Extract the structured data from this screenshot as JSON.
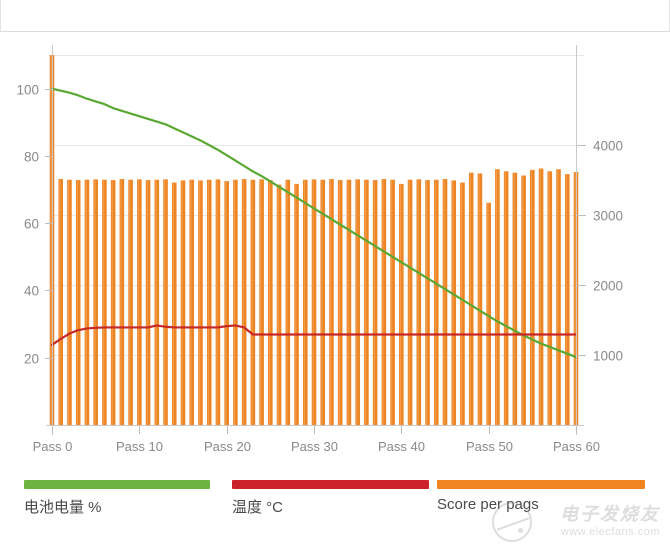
{
  "chart_data": {
    "type": "bar",
    "title": "",
    "subtitle": "",
    "xlabel": "",
    "ylabel": "",
    "y2label": "",
    "grid": true,
    "legend_position": "bottom",
    "x": [
      0,
      1,
      2,
      3,
      4,
      5,
      6,
      7,
      8,
      9,
      10,
      11,
      12,
      13,
      14,
      15,
      16,
      17,
      18,
      19,
      20,
      21,
      22,
      23,
      24,
      25,
      26,
      27,
      28,
      29,
      30,
      31,
      32,
      33,
      34,
      35,
      36,
      37,
      38,
      39,
      40,
      41,
      42,
      43,
      44,
      45,
      46,
      47,
      48,
      49,
      50,
      51,
      52,
      53,
      54,
      55,
      56,
      57,
      58,
      59,
      60
    ],
    "xtick_values": [
      0,
      10,
      20,
      30,
      40,
      50,
      60
    ],
    "xtick_labels": [
      "Pass 0",
      "Pass 10",
      "Pass 20",
      "Pass 30",
      "Pass 40",
      "Pass 50",
      "Pass 60"
    ],
    "ylim": [
      0,
      110
    ],
    "ytick_values": [
      20,
      40,
      60,
      80,
      100
    ],
    "ytick_labels": [
      "20",
      "40",
      "60",
      "80",
      "100"
    ],
    "y2lim": [
      0,
      5280
    ],
    "y2tick_values": [
      1000,
      2000,
      3000,
      4000
    ],
    "y2tick_labels": [
      "1000",
      "2000",
      "3000",
      "4000"
    ],
    "series": [
      {
        "name": "电池电量 %",
        "type": "line",
        "axis": "left",
        "color": "#5aa832",
        "values": [
          100,
          99.4,
          98.8,
          98.0,
          97.0,
          96.2,
          95.4,
          94.2,
          93.4,
          92.6,
          91.8,
          91.0,
          90.2,
          89.4,
          88.2,
          87.0,
          85.8,
          84.6,
          83.2,
          81.8,
          80.2,
          78.6,
          77.0,
          75.4,
          74.0,
          72.4,
          70.8,
          69.2,
          67.6,
          66.0,
          64.4,
          62.8,
          61.2,
          59.6,
          58.0,
          56.4,
          54.8,
          53.2,
          51.6,
          50.0,
          48.4,
          46.8,
          45.2,
          43.6,
          42.0,
          40.4,
          38.8,
          37.2,
          35.6,
          34.0,
          32.4,
          30.8,
          29.4,
          28.0,
          26.6,
          25.4,
          24.2,
          23.2,
          22.2,
          21.2,
          20.2
        ]
      },
      {
        "name": "温度 °C",
        "type": "line",
        "axis": "left",
        "color": "#c62828",
        "values": [
          23.8,
          25.6,
          27.2,
          28.2,
          28.7,
          28.9,
          29.0,
          29.0,
          29.0,
          29.0,
          29.0,
          29.0,
          29.6,
          29.2,
          29.0,
          29.0,
          29.0,
          29.0,
          29.0,
          29.0,
          29.4,
          29.6,
          29.0,
          26.9,
          26.9,
          26.9,
          26.9,
          26.9,
          26.9,
          26.9,
          26.9,
          26.9,
          26.9,
          26.9,
          26.9,
          26.9,
          26.9,
          26.9,
          26.9,
          26.9,
          26.9,
          26.9,
          26.9,
          26.9,
          26.9,
          26.9,
          26.9,
          26.9,
          26.9,
          26.9,
          26.9,
          26.9,
          26.9,
          26.9,
          26.9,
          26.9,
          26.9,
          26.9,
          26.9,
          26.9,
          26.9
        ]
      },
      {
        "name": "Score per pags",
        "type": "bar",
        "axis": "right",
        "color": "#ee8525",
        "values": [
          5280,
          3510,
          3500,
          3495,
          3500,
          3505,
          3500,
          3495,
          3510,
          3500,
          3505,
          3495,
          3500,
          3505,
          3460,
          3490,
          3500,
          3490,
          3500,
          3505,
          3480,
          3500,
          3510,
          3500,
          3505,
          3495,
          3430,
          3500,
          3440,
          3500,
          3505,
          3500,
          3510,
          3495,
          3500,
          3505,
          3500,
          3495,
          3510,
          3500,
          3440,
          3500,
          3505,
          3495,
          3500,
          3510,
          3490,
          3460,
          3600,
          3590,
          3170,
          3650,
          3620,
          3600,
          3560,
          3640,
          3660,
          3620,
          3650,
          3580,
          3610
        ]
      }
    ]
  },
  "legend": {
    "items": [
      {
        "label": "电池电量 %",
        "color": "#6cb33f"
      },
      {
        "label": "温度 °C",
        "color": "#cc2229"
      },
      {
        "label": "Score per pags",
        "color": "#f0841f"
      }
    ]
  },
  "watermark": {
    "cn_text": "电子发烧友",
    "url_text": "www.elecfans.com"
  }
}
